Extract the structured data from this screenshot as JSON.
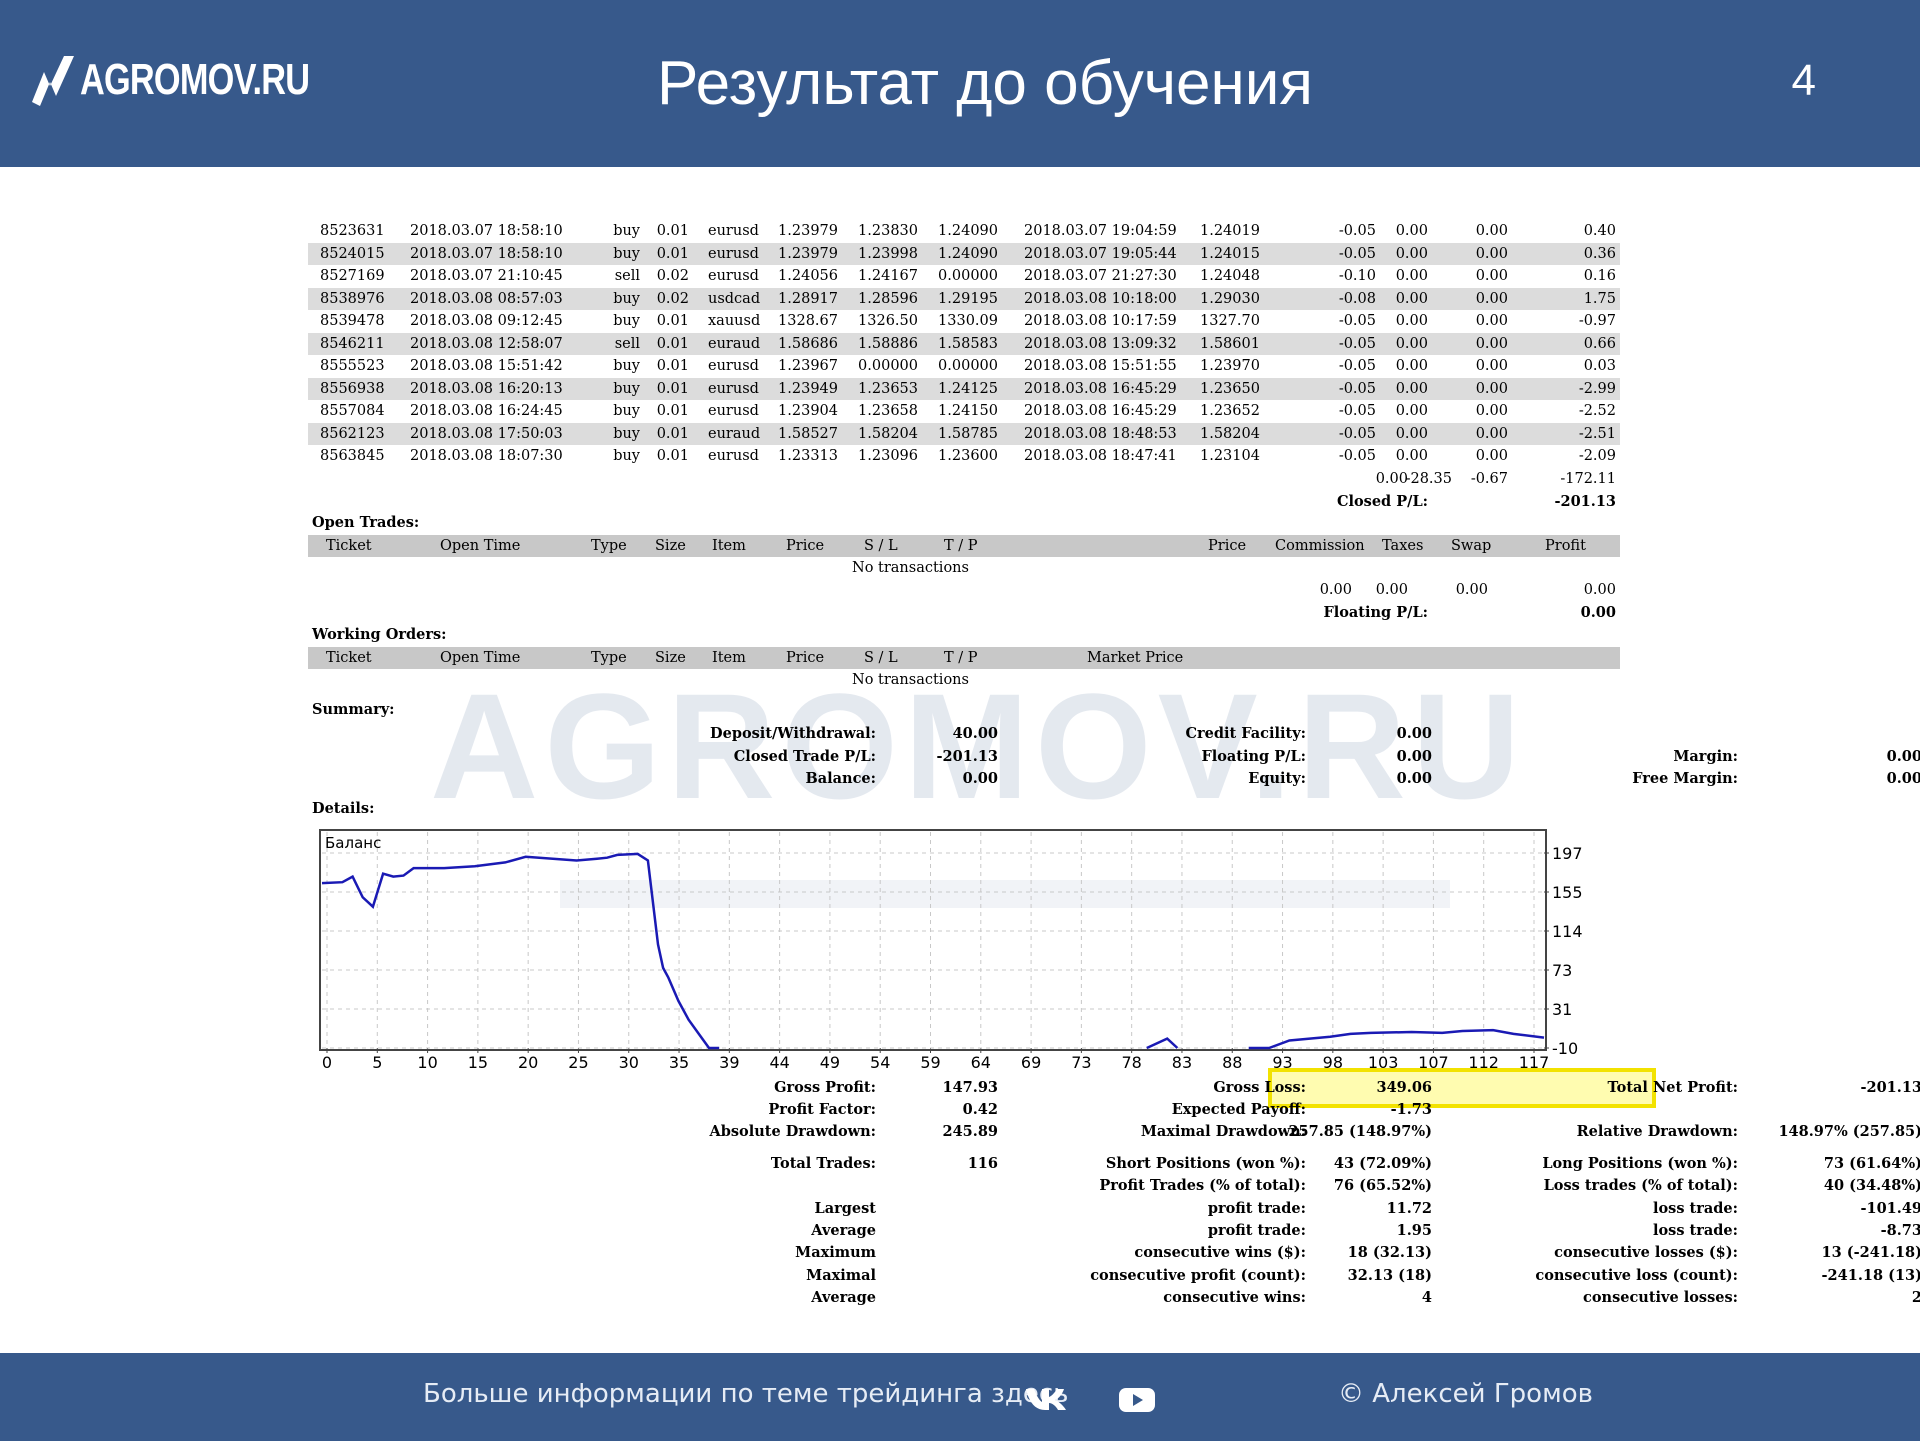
{
  "header": {
    "logo_text": "AGROMOV.RU",
    "title": "Результат до обучения",
    "page_number": "4"
  },
  "watermark": "AGROMOV.RU",
  "trades": [
    {
      "ticket": "8523631",
      "open_time": "2018.03.07 18:58:10",
      "type": "buy",
      "size": "0.01",
      "item": "eurusd",
      "price": "1.23979",
      "sl": "1.23830",
      "tp": "1.24090",
      "close_time": "2018.03.07 19:04:59",
      "close_price": "1.24019",
      "commission": "-0.05",
      "taxes": "0.00",
      "swap": "0.00",
      "profit": "0.40"
    },
    {
      "ticket": "8524015",
      "open_time": "2018.03.07 18:58:10",
      "type": "buy",
      "size": "0.01",
      "item": "eurusd",
      "price": "1.23979",
      "sl": "1.23998",
      "tp": "1.24090",
      "close_time": "2018.03.07 19:05:44",
      "close_price": "1.24015",
      "commission": "-0.05",
      "taxes": "0.00",
      "swap": "0.00",
      "profit": "0.36"
    },
    {
      "ticket": "8527169",
      "open_time": "2018.03.07 21:10:45",
      "type": "sell",
      "size": "0.02",
      "item": "eurusd",
      "price": "1.24056",
      "sl": "1.24167",
      "tp": "0.00000",
      "close_time": "2018.03.07 21:27:30",
      "close_price": "1.24048",
      "commission": "-0.10",
      "taxes": "0.00",
      "swap": "0.00",
      "profit": "0.16"
    },
    {
      "ticket": "8538976",
      "open_time": "2018.03.08 08:57:03",
      "type": "buy",
      "size": "0.02",
      "item": "usdcad",
      "price": "1.28917",
      "sl": "1.28596",
      "tp": "1.29195",
      "close_time": "2018.03.08 10:18:00",
      "close_price": "1.29030",
      "commission": "-0.08",
      "taxes": "0.00",
      "swap": "0.00",
      "profit": "1.75"
    },
    {
      "ticket": "8539478",
      "open_time": "2018.03.08 09:12:45",
      "type": "buy",
      "size": "0.01",
      "item": "xauusd",
      "price": "1328.67",
      "sl": "1326.50",
      "tp": "1330.09",
      "close_time": "2018.03.08 10:17:59",
      "close_price": "1327.70",
      "commission": "-0.05",
      "taxes": "0.00",
      "swap": "0.00",
      "profit": "-0.97"
    },
    {
      "ticket": "8546211",
      "open_time": "2018.03.08 12:58:07",
      "type": "sell",
      "size": "0.01",
      "item": "euraud",
      "price": "1.58686",
      "sl": "1.58886",
      "tp": "1.58583",
      "close_time": "2018.03.08 13:09:32",
      "close_price": "1.58601",
      "commission": "-0.05",
      "taxes": "0.00",
      "swap": "0.00",
      "profit": "0.66"
    },
    {
      "ticket": "8555523",
      "open_time": "2018.03.08 15:51:42",
      "type": "buy",
      "size": "0.01",
      "item": "eurusd",
      "price": "1.23967",
      "sl": "0.00000",
      "tp": "0.00000",
      "close_time": "2018.03.08 15:51:55",
      "close_price": "1.23970",
      "commission": "-0.05",
      "taxes": "0.00",
      "swap": "0.00",
      "profit": "0.03"
    },
    {
      "ticket": "8556938",
      "open_time": "2018.03.08 16:20:13",
      "type": "buy",
      "size": "0.01",
      "item": "eurusd",
      "price": "1.23949",
      "sl": "1.23653",
      "tp": "1.24125",
      "close_time": "2018.03.08 16:45:29",
      "close_price": "1.23650",
      "commission": "-0.05",
      "taxes": "0.00",
      "swap": "0.00",
      "profit": "-2.99"
    },
    {
      "ticket": "8557084",
      "open_time": "2018.03.08 16:24:45",
      "type": "buy",
      "size": "0.01",
      "item": "eurusd",
      "price": "1.23904",
      "sl": "1.23658",
      "tp": "1.24150",
      "close_time": "2018.03.08 16:45:29",
      "close_price": "1.23652",
      "commission": "-0.05",
      "taxes": "0.00",
      "swap": "0.00",
      "profit": "-2.52"
    },
    {
      "ticket": "8562123",
      "open_time": "2018.03.08 17:50:03",
      "type": "buy",
      "size": "0.01",
      "item": "euraud",
      "price": "1.58527",
      "sl": "1.58204",
      "tp": "1.58785",
      "close_time": "2018.03.08 18:48:53",
      "close_price": "1.58204",
      "commission": "-0.05",
      "taxes": "0.00",
      "swap": "0.00",
      "profit": "-2.51"
    },
    {
      "ticket": "8563845",
      "open_time": "2018.03.08 18:07:30",
      "type": "buy",
      "size": "0.01",
      "item": "eurusd",
      "price": "1.23313",
      "sl": "1.23096",
      "tp": "1.23600",
      "close_time": "2018.03.08 18:47:41",
      "close_price": "1.23104",
      "commission": "-0.05",
      "taxes": "0.00",
      "swap": "0.00",
      "profit": "-2.09"
    }
  ],
  "closed_totals": {
    "commission": "-28.35",
    "taxes": "0.00",
    "swap": "-0.67",
    "profit": "-172.11",
    "pl_label": "Closed P/L:",
    "pl_value": "-201.13"
  },
  "open_trades": {
    "title": "Open Trades:",
    "headers": {
      "ticket": "Ticket",
      "open_time": "Open Time",
      "type": "Type",
      "size": "Size",
      "item": "Item",
      "price": "Price",
      "sl": "S / L",
      "tp": "T / P",
      "price2": "Price",
      "commission": "Commission",
      "taxes": "Taxes",
      "swap": "Swap",
      "profit": "Profit"
    },
    "empty": "No transactions",
    "totals": {
      "commission": "0.00",
      "taxes": "0.00",
      "swap": "0.00",
      "profit": "0.00"
    },
    "pl_label": "Floating P/L:",
    "pl_value": "0.00"
  },
  "working_orders": {
    "title": "Working Orders:",
    "headers": {
      "ticket": "Ticket",
      "open_time": "Open Time",
      "type": "Type",
      "size": "Size",
      "item": "Item",
      "price": "Price",
      "sl": "S / L",
      "tp": "T / P",
      "market_price": "Market Price"
    },
    "empty": "No transactions"
  },
  "summary": {
    "title": "Summary:",
    "deposit_label": "Deposit/Withdrawal:",
    "deposit": "40.00",
    "credit_label": "Credit Facility:",
    "credit": "0.00",
    "closed_label": "Closed Trade P/L:",
    "closed": "-201.13",
    "floating_label": "Floating P/L:",
    "floating": "0.00",
    "margin_label": "Margin:",
    "margin": "0.00",
    "balance_label": "Balance:",
    "balance": "0.00",
    "equity_label": "Equity:",
    "equity": "0.00",
    "free_margin_label": "Free Margin:",
    "free_margin": "0.00"
  },
  "details_title": "Details:",
  "chart_data": {
    "type": "line",
    "title": "",
    "legend": "Баланс",
    "x_ticks": [
      "0",
      "5",
      "10",
      "15",
      "20",
      "25",
      "30",
      "35",
      "39",
      "44",
      "49",
      "54",
      "59",
      "64",
      "69",
      "73",
      "78",
      "83",
      "88",
      "93",
      "98",
      "103",
      "107",
      "112",
      "117"
    ],
    "y_ticks": [
      "197",
      "155",
      "114",
      "73",
      "31",
      "-10"
    ],
    "xlim": [
      0,
      120
    ],
    "ylim": [
      -10,
      222
    ],
    "grid": true,
    "line_color": "#1a1ab4",
    "series": [
      {
        "x": [
          0,
          2,
          3,
          4,
          5,
          6,
          7,
          8,
          9,
          12,
          15,
          18,
          20,
          25,
          27,
          28,
          29,
          31,
          32,
          33,
          33.5,
          34,
          35,
          36,
          37,
          38,
          39
        ],
        "y": [
          165,
          166,
          172,
          150,
          140,
          175,
          172,
          173,
          181,
          181,
          183,
          187,
          193,
          189,
          191,
          192,
          195,
          196,
          189,
          100,
          75,
          65,
          40,
          20,
          5,
          -10,
          -10
        ]
      },
      {
        "x": [
          81,
          83,
          84
        ],
        "y": [
          -10,
          0,
          -10
        ]
      },
      {
        "x": [
          91,
          93,
          95,
          99,
          101,
          103,
          107,
          110,
          112,
          115,
          117,
          120
        ],
        "y": [
          -10,
          -10,
          -2,
          2,
          5,
          6,
          7,
          6,
          8,
          9,
          5,
          1
        ]
      }
    ]
  },
  "stats": {
    "gross_profit_label": "Gross Profit:",
    "gross_profit": "147.93",
    "gross_loss_label": "Gross Loss:",
    "gross_loss": "349.06",
    "total_net_label": "Total Net Profit:",
    "total_net": "-201.13",
    "profit_factor_label": "Profit Factor:",
    "profit_factor": "0.42",
    "expected_payoff_label": "Expected Payoff:",
    "expected_payoff": "-1.73",
    "abs_dd_label": "Absolute Drawdown:",
    "abs_dd": "245.89",
    "max_dd_label": "Maximal Drawdown:",
    "max_dd": "257.85 (148.97%)",
    "rel_dd_label": "Relative Drawdown:",
    "rel_dd": "148.97% (257.85)",
    "total_trades_label": "Total Trades:",
    "total_trades": "116",
    "short_label": "Short Positions (won %):",
    "short": "43 (72.09%)",
    "long_label": "Long Positions (won %):",
    "long": "73 (61.64%)",
    "profit_trades_label": "Profit Trades (% of total):",
    "profit_trades": "76 (65.52%)",
    "loss_trades_label": "Loss trades (% of total):",
    "loss_trades": "40 (34.48%)",
    "largest": "Largest",
    "average": "Average",
    "maximum": "Maximum",
    "maximal": "Maximal",
    "average2": "Average",
    "largest_profit_label": "profit trade:",
    "largest_profit": "11.72",
    "largest_loss_label": "loss trade:",
    "largest_loss": "-101.49",
    "avg_profit_label": "profit trade:",
    "avg_profit": "1.95",
    "avg_loss_label": "loss trade:",
    "avg_loss": "-8.73",
    "max_wins_label": "consecutive wins ($):",
    "max_wins": "18 (32.13)",
    "max_losses_label": "consecutive losses ($):",
    "max_losses": "13 (-241.18)",
    "maximal_profit_label": "consecutive profit (count):",
    "maximal_profit": "32.13 (18)",
    "maximal_loss_label": "consecutive loss (count):",
    "maximal_loss": "-241.18 (13)",
    "avg_wins_label": "consecutive wins:",
    "avg_wins": "4",
    "avg_losses_label": "consecutive losses:",
    "avg_losses": "2"
  },
  "footer": {
    "text": "Больше информации по теме трейдинга здесь",
    "copyright": "© Алексей Громов",
    "icons": [
      "vk-icon",
      "youtube-icon"
    ]
  }
}
